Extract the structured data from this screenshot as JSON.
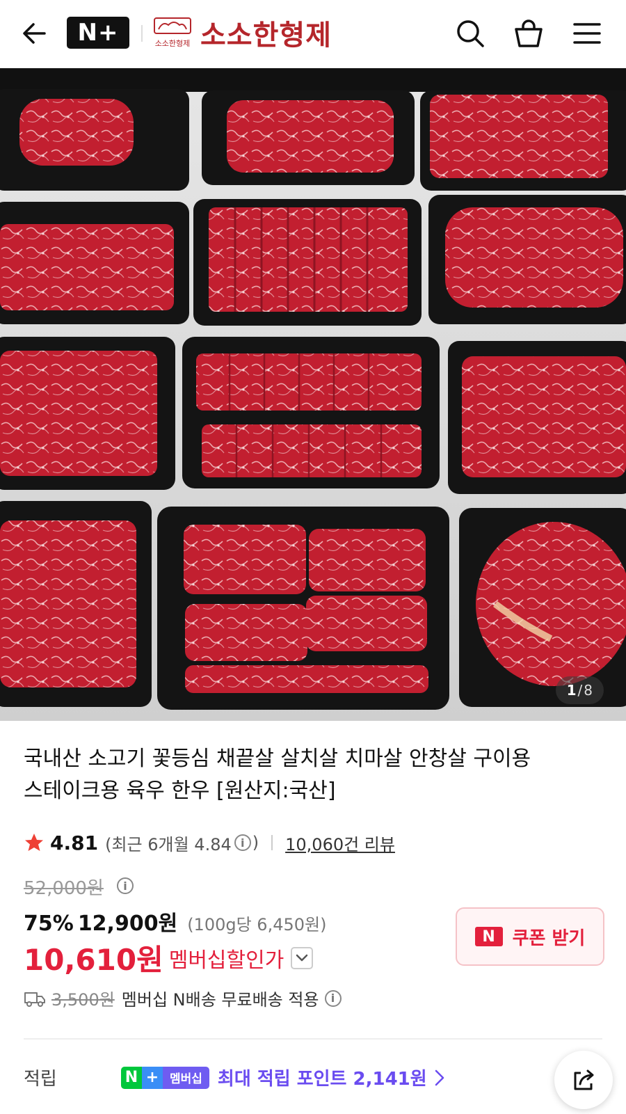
{
  "header": {
    "brand_badge": "N+",
    "store_name": "소소한형제",
    "store_logo_text": "소소한형제"
  },
  "hero": {
    "current_index": "1",
    "separator": "/",
    "total": "8"
  },
  "product": {
    "title_line1": "국내산 소고기 꽃등심 채끝살 살치살 치마살 안창살 구이용",
    "title_line2": "스테이크용 육우 한우 [원산지:국산]"
  },
  "rating": {
    "score": "4.81",
    "recent_prefix": "(최근 6개월 4.84",
    "recent_suffix": ")",
    "info_glyph": "i",
    "review_link": "10,060건 리뷰"
  },
  "price": {
    "original": "52,000원",
    "discount_rate": "75%",
    "sale_price": "12,900원",
    "unit_price": "(100g당 6,450원)",
    "member_price": "10,610원",
    "member_label": "멤버십할인가"
  },
  "coupon": {
    "badge": "N",
    "label": "쿠폰 받기"
  },
  "shipping": {
    "fee": "3,500원",
    "note": "멤버십 N배송 무료배송 적용"
  },
  "points": {
    "label": "적립",
    "badge_n": "N",
    "badge_plus": "+",
    "badge_text": "멤버십",
    "text": "최대 적립 포인트 2,141원"
  },
  "colors": {
    "brand_red": "#b5262b",
    "sale_red": "#e3203c",
    "points_purple": "#6a4cf0",
    "naver_green": "#00c73c"
  },
  "icons": {
    "back": "arrow-left-icon",
    "search": "search-icon",
    "cart": "shopping-bag-icon",
    "menu": "hamburger-menu-icon",
    "star": "star-icon",
    "truck": "delivery-truck-icon",
    "share": "share-icon"
  }
}
